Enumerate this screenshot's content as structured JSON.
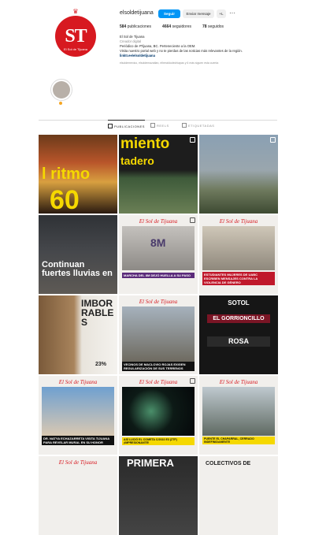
{
  "header": {
    "username": "elsoldetijuana",
    "follow_label": "Seguir",
    "message_label": "Enviar mensaje",
    "add_label": "+L",
    "more_label": "···",
    "avatar_logo": "ST",
    "avatar_sub": "El Sol de Tijuana"
  },
  "stats": {
    "posts_count": "584",
    "posts_label": "publicaciones",
    "followers_count": "4664",
    "followers_label": "seguidores",
    "following_count": "78",
    "following_label": "seguidos"
  },
  "bio": {
    "name": "El Sol de Tijuana",
    "category": "Creador digital",
    "line1": "Periódico de #Tijuana, BC. Perteneciente a la OEM.",
    "line2": "Visita nuestro portal web y no te pierdas de las noticias más relevantes de la región.",
    "link": "linktr.ee/elsoldetijuana"
  },
  "tagged_line": "elsoldemexico, elsoldemazatlan, elheraldodechiapas y 6 más siguen esta cuenta",
  "tabs": [
    {
      "label": "PUBLICACIONES"
    },
    {
      "label": "REELS"
    },
    {
      "label": "ETIQUETADAS"
    }
  ],
  "grid": {
    "brand_label": "El Sol de Tijuana",
    "p1_text": "l ritmo",
    "p1_big": "60",
    "p2_text": "miento",
    "p2_sub": "tadero",
    "p4_text": "Continuan fuertes lluvias en",
    "p5_sign": "8M",
    "p5_caption": "MARCHA DEL 8M DEJÓ HUELLA A SU PASO",
    "p6_caption": "ESTUDIANTES MUJERES DE UABC ESCRIBEN MENSAJES CONTRA LA VIOLENCIA DE GÉNERO",
    "p7_text": "IMBORRABLES",
    "p7_stat": "23%",
    "p8_caption": "VECINOS DE MACLOVIO ROJAS EXIGEN REGULARIZACIÓN DE SUS TERRENOS",
    "p9_brand": "SOTOL",
    "p9_title": "EL GORRIONCILLO",
    "p9_sub": "ROSA",
    "p10_caption": "DR. NATYA ECHAZARRETA VISITA TIJUANA PARA REVELAR MURAL EN SU HONOR",
    "p11_caption": "ASÍ LUCIÓ EL COMETA C/2022 E3 (ZTF) ¡IMPRESIONANTE!",
    "p12_caption": "PUENTE EL CHAPARRAL, CERRADO INDEFINIDAMENTE",
    "p14_text": "PRIMERA",
    "p15_text": "COLECTIVOS DE"
  },
  "colors": {
    "accent": "#0095f6",
    "brand_red": "#d71920",
    "yellow": "#f5d800"
  }
}
